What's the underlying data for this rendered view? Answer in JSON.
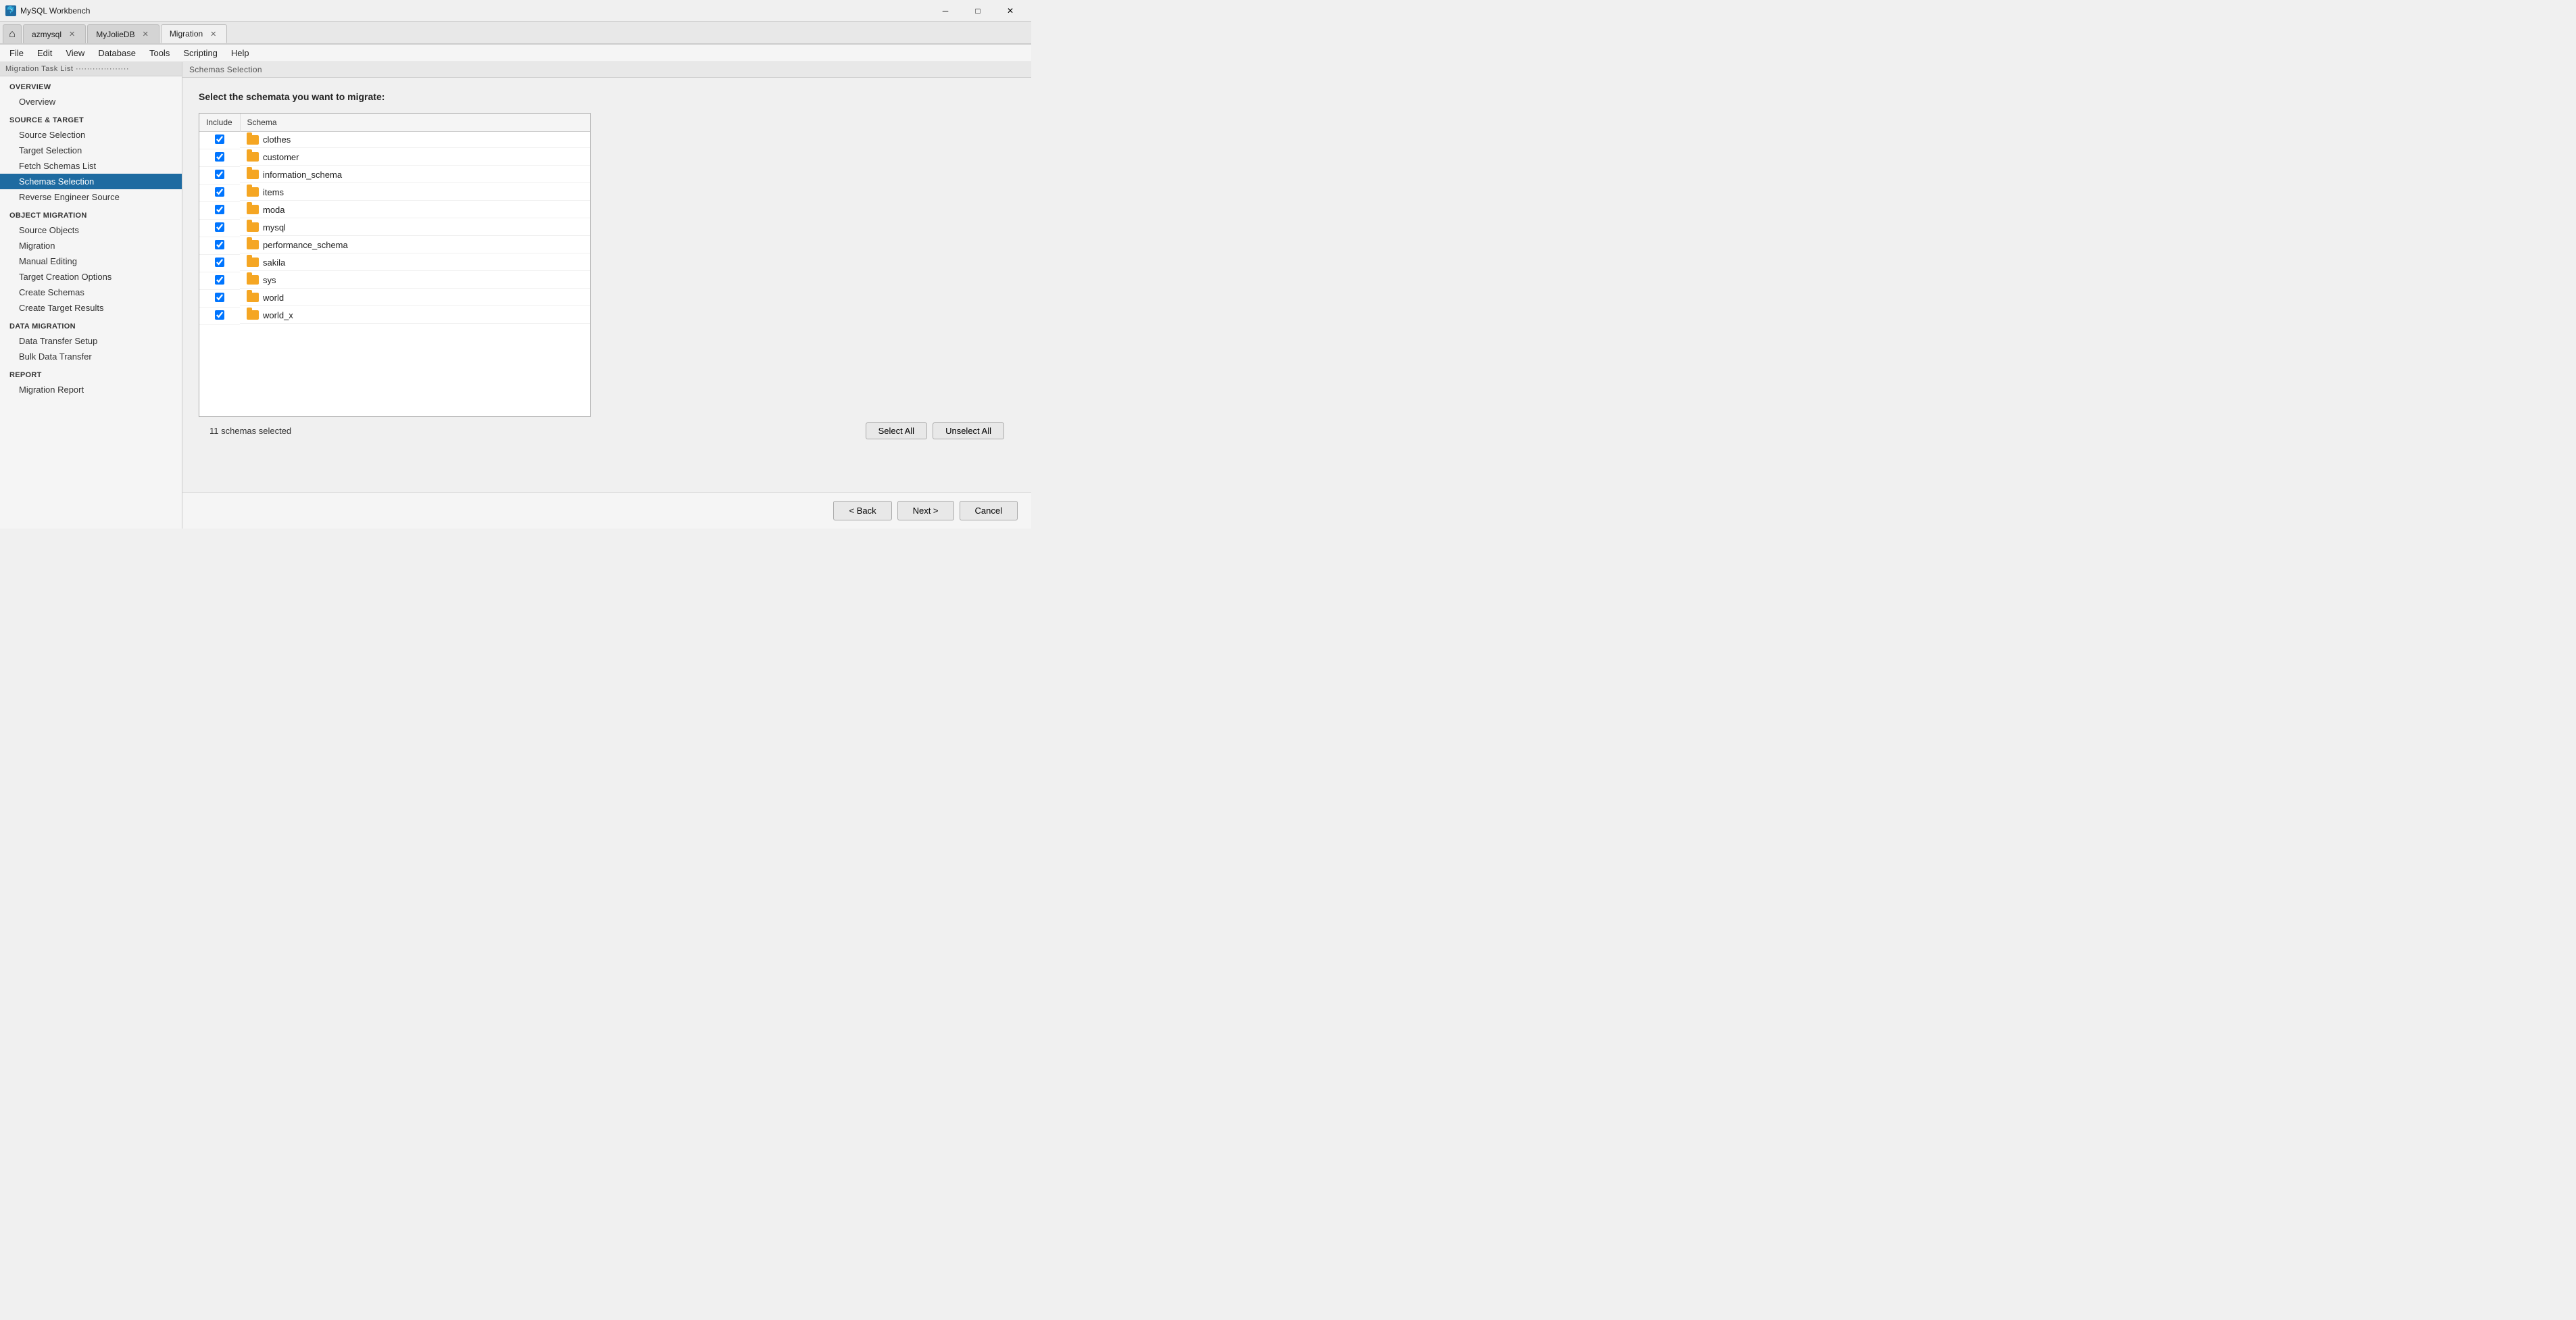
{
  "app": {
    "title": "MySQL Workbench",
    "title_icon": "🐬"
  },
  "title_bar": {
    "min_btn": "─",
    "max_btn": "□",
    "close_btn": "✕"
  },
  "tabs": [
    {
      "id": "home",
      "label": "",
      "icon": "⌂",
      "closable": false
    },
    {
      "id": "azmysql",
      "label": "azmysql",
      "closable": true
    },
    {
      "id": "myjoliedb",
      "label": "MyJolieDB",
      "closable": true
    },
    {
      "id": "migration",
      "label": "Migration",
      "closable": true,
      "active": true
    }
  ],
  "menu": {
    "items": [
      "File",
      "Edit",
      "View",
      "Database",
      "Tools",
      "Scripting",
      "Help"
    ]
  },
  "sidebar": {
    "header": "Migration Task List ···················",
    "sections": [
      {
        "id": "overview",
        "title": "OVERVIEW",
        "items": [
          {
            "id": "overview",
            "label": "Overview",
            "active": false
          }
        ]
      },
      {
        "id": "source_target",
        "title": "SOURCE & TARGET",
        "items": [
          {
            "id": "source_selection",
            "label": "Source Selection",
            "active": false
          },
          {
            "id": "target_selection",
            "label": "Target Selection",
            "active": false
          },
          {
            "id": "fetch_schemas",
            "label": "Fetch Schemas List",
            "active": false
          },
          {
            "id": "schemas_selection",
            "label": "Schemas Selection",
            "active": true
          },
          {
            "id": "reverse_engineer",
            "label": "Reverse Engineer Source",
            "active": false
          }
        ]
      },
      {
        "id": "object_migration",
        "title": "OBJECT MIGRATION",
        "items": [
          {
            "id": "source_objects",
            "label": "Source Objects",
            "active": false
          },
          {
            "id": "migration",
            "label": "Migration",
            "active": false
          },
          {
            "id": "manual_editing",
            "label": "Manual Editing",
            "active": false
          },
          {
            "id": "target_creation",
            "label": "Target Creation Options",
            "active": false
          },
          {
            "id": "create_schemas",
            "label": "Create Schemas",
            "active": false
          },
          {
            "id": "create_target_results",
            "label": "Create Target Results",
            "active": false
          }
        ]
      },
      {
        "id": "data_migration",
        "title": "DATA MIGRATION",
        "items": [
          {
            "id": "data_transfer_setup",
            "label": "Data Transfer Setup",
            "active": false
          },
          {
            "id": "bulk_data_transfer",
            "label": "Bulk Data Transfer",
            "active": false
          }
        ]
      },
      {
        "id": "report",
        "title": "REPORT",
        "items": [
          {
            "id": "migration_report",
            "label": "Migration Report",
            "active": false
          }
        ]
      }
    ]
  },
  "content": {
    "header": "Schemas Selection",
    "title": "Select the schemata you want to migrate:",
    "table": {
      "columns": [
        "Include",
        "Schema"
      ],
      "rows": [
        {
          "name": "clothes",
          "checked": true
        },
        {
          "name": "customer",
          "checked": true
        },
        {
          "name": "information_schema",
          "checked": true
        },
        {
          "name": "items",
          "checked": true
        },
        {
          "name": "moda",
          "checked": true
        },
        {
          "name": "mysql",
          "checked": true
        },
        {
          "name": "performance_schema",
          "checked": true
        },
        {
          "name": "sakila",
          "checked": true
        },
        {
          "name": "sys",
          "checked": true
        },
        {
          "name": "world",
          "checked": true
        },
        {
          "name": "world_x",
          "checked": true
        }
      ]
    },
    "status_text": "11 schemas selected",
    "select_all_btn": "Select All",
    "unselect_all_btn": "Unselect All"
  },
  "navigation": {
    "back_btn": "< Back",
    "next_btn": "Next >",
    "cancel_btn": "Cancel"
  }
}
